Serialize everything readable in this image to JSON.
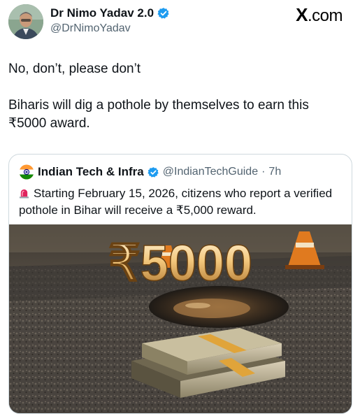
{
  "author": {
    "display_name": "Dr Nimo Yadav 2.0",
    "handle": "@DrNimoYadav",
    "verified_icon": "verified-badge-icon",
    "badge_color": "#1d9bf0"
  },
  "site_mark": {
    "x": "X",
    "suffix": ".com"
  },
  "tweet": {
    "line1": "No, don’t, please don’t",
    "line2": "Biharis will dig a pothole by themselves to earn this ₹5000 award."
  },
  "quoted": {
    "display_name": "Indian Tech & Infra",
    "handle": "@IndianTechGuide",
    "separator": "·",
    "time": "7h",
    "avatar_icon": "india-flag-wheel-icon",
    "siren_icon": "siren-icon",
    "body": "Starting February 15, 2026, citizens who report a verified pothole in Bihar will receive a ₹5,000 reward.",
    "image": {
      "overlay_text": "₹5000",
      "description_icon": "pothole-with-cash-stack-image"
    }
  }
}
